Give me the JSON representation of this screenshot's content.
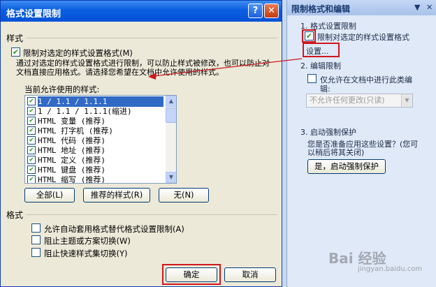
{
  "dialog": {
    "title": "格式设置限制",
    "help_label": "?",
    "close_label": "✕",
    "section_styles": "样式",
    "restrict_checkbox_label": "限制对选定的样式设置格式(M)",
    "description": "通过对选定的样式设置格式进行限制，可以防止样式被修改，也可以防止对文档直接应用格式。请选择您希望在文档中允许使用的样式。",
    "allowed_label": "当前允许使用的样式:",
    "list_items": [
      "1 / 1.1 / 1.1.1",
      "1 / 1.1 / 1.1.1(缩进)",
      "HTML 变量 (推荐)",
      "HTML 打字机 (推荐)",
      "HTML 代码 (推荐)",
      "HTML 地址 (推荐)",
      "HTML 定义 (推荐)",
      "HTML 键盘 (推荐)",
      "HTML 缩写 (推荐)"
    ],
    "btn_all": "全部(L)",
    "btn_recommended": "推荐的样式(R)",
    "btn_none": "无(N)",
    "section_format": "格式",
    "opt_autoformat": "允许自动套用格式替代格式设置限制(A)",
    "opt_theme": "阻止主题或方案切换(W)",
    "opt_quickstyle": "阻止快速样式集切换(Y)",
    "btn_ok": "确定",
    "btn_cancel": "取消"
  },
  "pane": {
    "title": "限制格式和编辑",
    "dropdown_icon": "▼",
    "close_icon": "✕",
    "section1_heading": "1. 格式设置限制",
    "section1_checkbox": "限制对选定的样式设置格式",
    "settings_link": "设置...",
    "section2_heading": "2. 编辑限制",
    "section2_checkbox_line1": "仅允许在文档中进行此类编",
    "section2_checkbox_line2": "辑:",
    "section2_combo": "不允许任何更改(只读)",
    "section3_heading": "3. 启动强制保护",
    "section3_question_line1": "您是否准备应用这些设置？(您可",
    "section3_question_line2": "以稍后将其关闭)",
    "section3_button": "是，启动强制保护"
  },
  "watermark": {
    "text": "Bai 经验",
    "sub": "jingyan.baidu.com"
  },
  "colors": {
    "titlebar": "#0a5ee0",
    "highlight": "#d0161e",
    "selection": "#316ac5"
  }
}
